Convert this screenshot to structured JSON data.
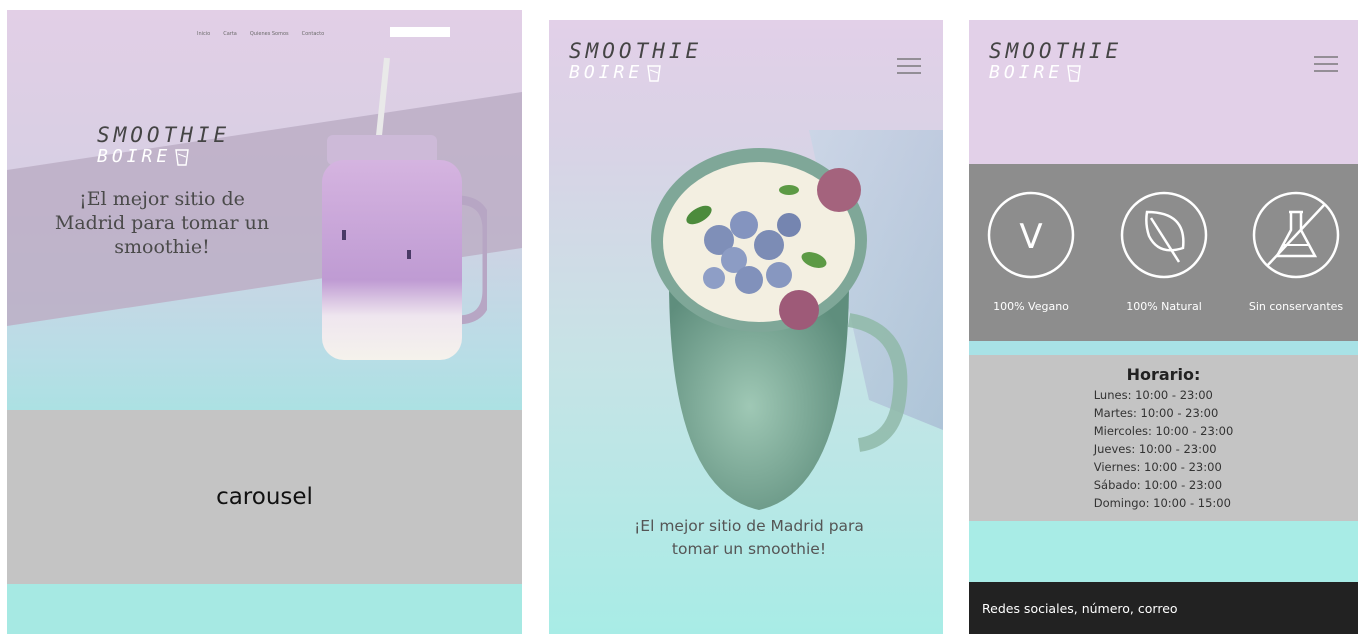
{
  "desktop": {
    "nav": {
      "items": [
        "Inicio",
        "Carta",
        "Quienes Somos",
        "Contacto"
      ]
    },
    "logo": {
      "line1": "SMOOTHIE",
      "line2": "BOIRE"
    },
    "hero_text": "¡El mejor sitio de Madrid para tomar un smoothie!",
    "carousel_label": "carousel"
  },
  "mobile_hero": {
    "logo": {
      "line1": "SMOOTHIE",
      "line2": "BOIRE"
    },
    "hero_text": "¡El mejor sitio de Madrid para tomar un smoothie!"
  },
  "mobile_info": {
    "logo": {
      "line1": "SMOOTHIE",
      "line2": "BOIRE"
    },
    "features": [
      {
        "icon": "vegan-v-icon",
        "label": "100% Vegano"
      },
      {
        "icon": "leaf-icon",
        "label": "100% Natural"
      },
      {
        "icon": "no-chemicals-flask-icon",
        "label": "Sin conservantes"
      }
    ],
    "hours": {
      "title": "Horario:",
      "rows": [
        "Lunes: 10:00 - 23:00",
        "Martes: 10:00 - 23:00",
        "Miercoles: 10:00 - 23:00",
        "Jueves: 10:00 - 23:00",
        "Viernes: 10:00 - 23:00",
        "Sábado: 10:00 - 23:00",
        "Domingo: 10:00 - 15:00"
      ]
    },
    "footer_text": "Redes sociales, número, correo"
  },
  "colors": {
    "lilac": "#e2d0e8",
    "teal": "#a8ece6",
    "gray": "#c4c4c4",
    "dark_gray": "#8d8d8d",
    "footer": "#222222"
  }
}
